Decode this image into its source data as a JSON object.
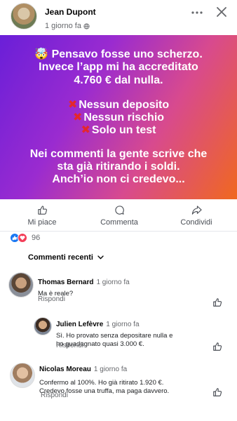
{
  "post": {
    "author": "Jean Dupont",
    "time": "1 giorno fa"
  },
  "banner": {
    "lines": [
      "🤯 Pensavo fosse uno scherzo.",
      "Invece l’app mi ha accreditato",
      "4.760 € dal nulla.",
      "Nessun deposito",
      "Nessun rischio",
      "Solo un test",
      "Nei commenti la gente scrive che",
      "sta già ritirando i soldi.",
      "Anch’io non ci credevo..."
    ],
    "x_mark": "✖"
  },
  "actions": {
    "like": "Mi piace",
    "comment": "Commenta",
    "share": "Condividi"
  },
  "reactions": {
    "count": "96"
  },
  "comments_sort": "Commenti recenti",
  "comments": [
    {
      "name": "Thomas Bernard",
      "time": "1 giorno fa",
      "text": [
        "Ma è reale?"
      ],
      "reply": "Rispondi"
    },
    {
      "name": "Julien Lefèvre",
      "time": "1 giorno fa",
      "text": [
        "Sì. Ho provato senza depositare nulla e",
        "ho guadagnato quasi 3.000 €."
      ],
      "reply": "Rispondi"
    },
    {
      "name": "Nicolas Moreau",
      "time": "1 giorno fa",
      "text": [
        "Confermo al 100%. Ho già ritirato 1.920 €.",
        "Credevo fosse una truffa, ma paga davvero."
      ],
      "reply": "Rispondi"
    }
  ],
  "colors": {
    "gradient_start": "#6a1fd8",
    "gradient_end": "#f0681f",
    "x_red": "#e4272c",
    "like_blue": "#1877f2",
    "love_red": "#f33e58"
  }
}
